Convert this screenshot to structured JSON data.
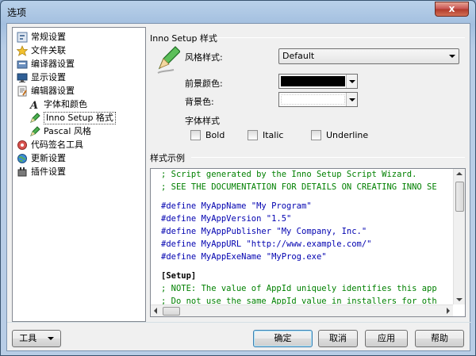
{
  "window": {
    "title": "选项",
    "close_glyph": "x"
  },
  "tree": {
    "items": [
      {
        "label": "常规设置",
        "icon": "general-settings-icon"
      },
      {
        "label": "文件关联",
        "icon": "star-icon"
      },
      {
        "label": "编译器设置",
        "icon": "compiler-icon"
      },
      {
        "label": "显示设置",
        "icon": "monitor-icon"
      },
      {
        "label": "编辑器设置",
        "icon": "editor-icon"
      },
      {
        "label": "字体和颜色",
        "icon": "font-icon"
      },
      {
        "label": "Inno Setup 格式",
        "icon": "pencil-icon"
      },
      {
        "label": "Pascal 风格",
        "icon": "pencil-icon"
      },
      {
        "label": "代码签名工具",
        "icon": "signing-icon"
      },
      {
        "label": "更新设置",
        "icon": "globe-icon"
      },
      {
        "label": "插件设置",
        "icon": "plugin-icon"
      }
    ]
  },
  "style_section": {
    "title": "Inno Setup 样式",
    "style_label": "风格样式:",
    "style_value": "Default",
    "fg_label": "前景颜色:",
    "fg_color": "#000000",
    "bg_label": "背景色:",
    "bg_color": "#ffffff",
    "font_style_label": "字体样式",
    "bold_label": "Bold",
    "italic_label": "Italic",
    "underline_label": "Underline"
  },
  "preview": {
    "title": "样式示例",
    "lines": [
      {
        "text": "; Script generated by the Inno Setup Script Wizard.",
        "kind": "comment"
      },
      {
        "text": "; SEE THE DOCUMENTATION FOR DETAILS ON CREATING INNO SE",
        "kind": "comment"
      },
      {
        "text": "",
        "kind": "blank"
      },
      {
        "text": "#define MyAppName \"My Program\"",
        "kind": "define"
      },
      {
        "text": "#define MyAppVersion \"1.5\"",
        "kind": "define"
      },
      {
        "text": "#define MyAppPublisher \"My Company, Inc.\"",
        "kind": "define"
      },
      {
        "text": "#define MyAppURL \"http://www.example.com/\"",
        "kind": "define"
      },
      {
        "text": "#define MyAppExeName \"MyProg.exe\"",
        "kind": "define"
      },
      {
        "text": "",
        "kind": "blank"
      },
      {
        "text": "[Setup]",
        "kind": "section"
      },
      {
        "text": "; NOTE: The value of AppId uniquely identifies this app",
        "kind": "comment"
      },
      {
        "text": "; Do not use the same AppId value in installers for oth",
        "kind": "comment"
      }
    ]
  },
  "buttons": {
    "tools": "工具",
    "ok": "确定",
    "cancel": "取消",
    "apply": "应用",
    "help": "帮助"
  }
}
